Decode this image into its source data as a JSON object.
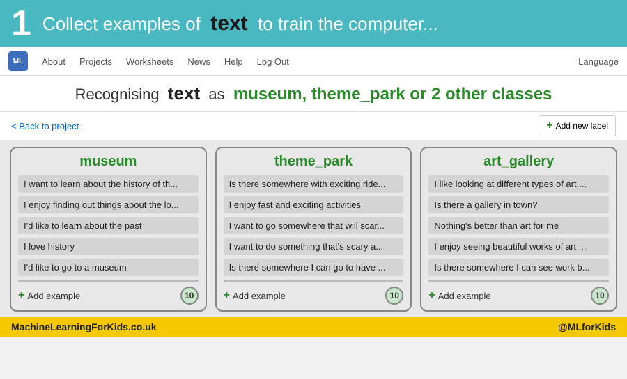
{
  "header": {
    "number": "1",
    "prefix": "Collect examples of",
    "bold_word": "text",
    "suffix": "to train the computer..."
  },
  "nav": {
    "links": [
      "About",
      "Projects",
      "Worksheets",
      "News",
      "Help",
      "Log Out"
    ],
    "language_label": "Language"
  },
  "sub_header": {
    "prefix": "Recognising",
    "word": "text",
    "middle": "as",
    "classes": "museum, theme_park or 2 other classes"
  },
  "back_link": "< Back to project",
  "add_label_btn": "Add new label",
  "columns": [
    {
      "title": "museum",
      "examples": [
        "I want to learn about the history of th...",
        "I enjoy finding out things about the lo...",
        "I'd like to learn about the past",
        "I love history",
        "I'd like to go to a museum"
      ],
      "add_example": "Add example",
      "count": "10"
    },
    {
      "title": "theme_park",
      "examples": [
        "Is there somewhere with exciting ride...",
        "I enjoy fast and exciting activities",
        "I want to go somewhere that will scar...",
        "I want to do something that's scary a...",
        "Is there somewhere I can go to have ..."
      ],
      "add_example": "Add example",
      "count": "10"
    },
    {
      "title": "art_gallery",
      "examples": [
        "I like looking at different types of art ...",
        "Is there a gallery in town?",
        "Nothing's better than art for me",
        "I enjoy seeing beautiful works of art ...",
        "Is there somewhere I can see work b..."
      ],
      "add_example": "Add example",
      "count": "10"
    }
  ],
  "footer": {
    "left": "MachineLearningForKids.co.uk",
    "right": "@MLforKids"
  }
}
